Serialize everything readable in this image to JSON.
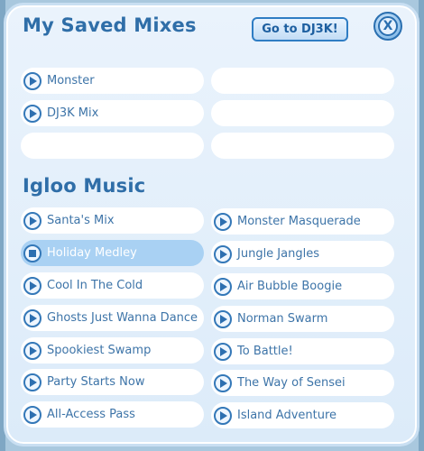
{
  "header": {
    "saved_title": "My Saved Mixes",
    "dj_button": "Go to DJ3K!",
    "close_glyph": "X"
  },
  "saved_mixes": [
    {
      "label": "Monster"
    },
    {
      "label": ""
    },
    {
      "label": "DJ3K Mix"
    },
    {
      "label": ""
    },
    {
      "label": ""
    },
    {
      "label": ""
    }
  ],
  "igloo": {
    "title": "Igloo Music",
    "tracks": [
      {
        "label": "Santa's Mix",
        "icon": "play"
      },
      {
        "label": "Monster Masquerade",
        "icon": "play"
      },
      {
        "label": "Holiday Medley",
        "icon": "stop",
        "selected": true
      },
      {
        "label": "Jungle Jangles",
        "icon": "play"
      },
      {
        "label": "Cool In The Cold",
        "icon": "play"
      },
      {
        "label": "Air Bubble Boogie",
        "icon": "play"
      },
      {
        "label": "Ghosts Just Wanna Dance",
        "icon": "play"
      },
      {
        "label": "Norman Swarm",
        "icon": "play"
      },
      {
        "label": "Spookiest Swamp",
        "icon": "play"
      },
      {
        "label": "To Battle!",
        "icon": "play"
      },
      {
        "label": "Party Starts Now",
        "icon": "play"
      },
      {
        "label": "The Way of Sensei",
        "icon": "play"
      },
      {
        "label": "All-Access Pass",
        "icon": "play"
      },
      {
        "label": "Island Adventure",
        "icon": "play"
      }
    ]
  },
  "colors": {
    "title": "#2f6ea8",
    "selected_row": "#a9d1f3",
    "accent": "#3478b8"
  }
}
